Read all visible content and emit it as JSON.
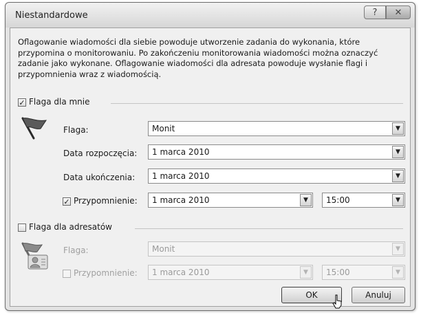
{
  "window": {
    "title": "Niestandardowe",
    "help_label": "?",
    "close_label": "✕"
  },
  "description": "Oflagowanie wiadomości dla siebie powoduje utworzenie zadania do wykonania, które przypomina o monitorowaniu. Po zakończeniu monitorowania wiadomości można oznaczyć zadanie jako wykonane. Oflagowanie wiadomości dla adresata powoduje wysłanie flagi i przypomnienia wraz z wiadomością.",
  "flag_for_me": {
    "checkbox_label": "Flaga dla mnie",
    "checked": true,
    "flag_label": "Flaga:",
    "flag_value": "Monit",
    "start_label": "Data rozpoczęcia:",
    "start_value": "1 marca 2010",
    "due_label": "Data ukończenia:",
    "due_value": "1 marca 2010",
    "reminder_label": "Przypomnienie:",
    "reminder_checked": true,
    "reminder_date": "1 marca 2010",
    "reminder_time": "15:00"
  },
  "flag_for_recipients": {
    "checkbox_label": "Flaga dla adresatów",
    "checked": false,
    "flag_label": "Flaga:",
    "flag_value": "Monit",
    "reminder_label": "Przypomnienie:",
    "reminder_checked": false,
    "reminder_date": "1 marca 2010",
    "reminder_time": "15:00"
  },
  "buttons": {
    "ok": "OK",
    "cancel": "Anuluj"
  },
  "glyphs": {
    "check": "✓",
    "dropdown": "▼"
  }
}
